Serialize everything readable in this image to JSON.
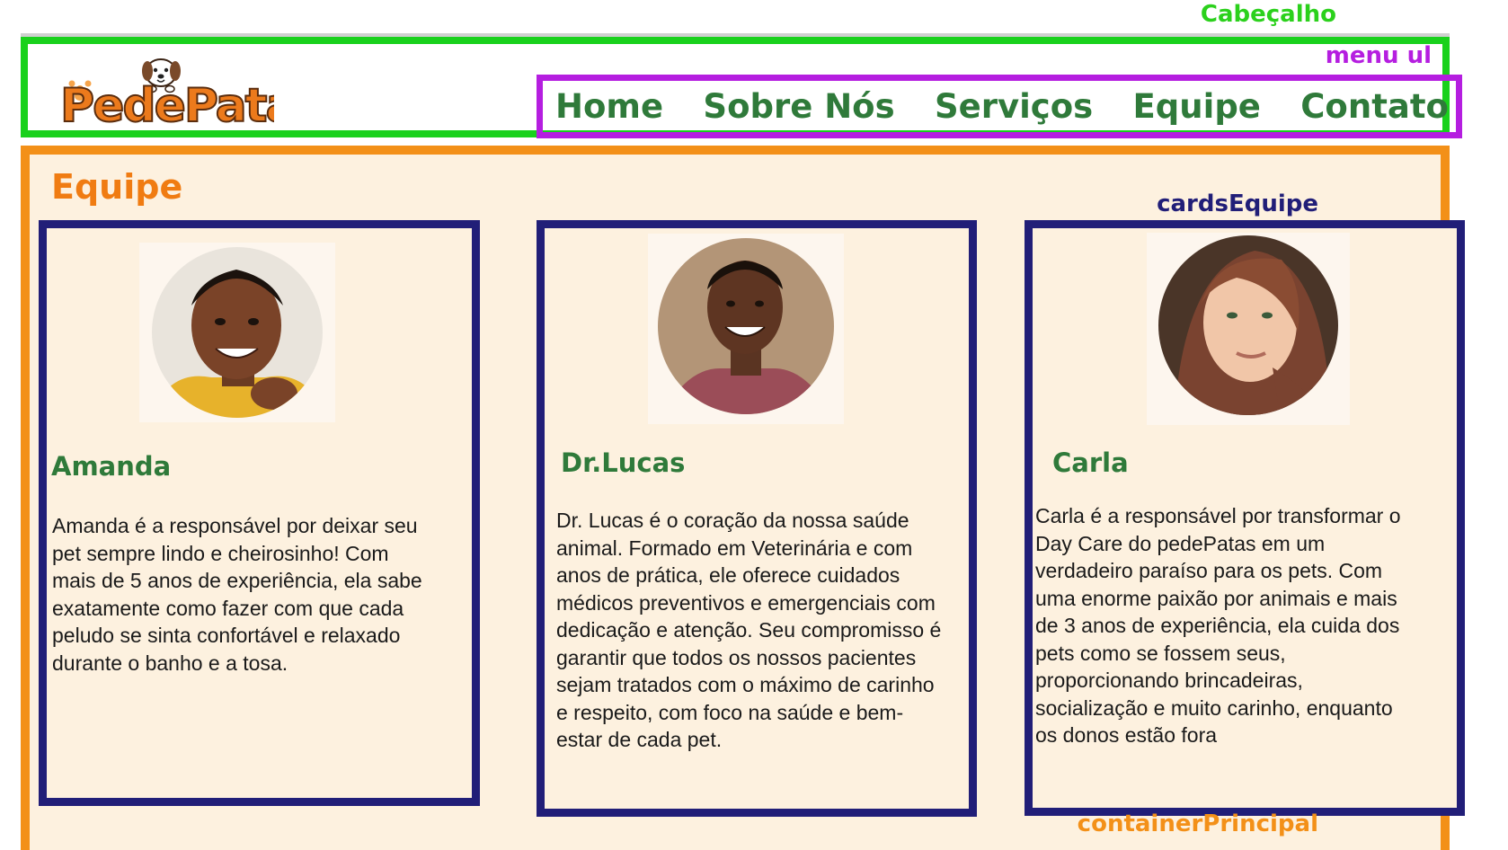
{
  "annotations": {
    "header": "Cabeçalho",
    "menu": "menu ul",
    "cards": "cardsEquipe",
    "main": "containerPrincipal"
  },
  "logo": {
    "text": "PedePata"
  },
  "menu": [
    "Home",
    "Sobre Nós",
    "Serviços",
    "Equipe",
    "Contato"
  ],
  "main": {
    "title": "Equipe"
  },
  "team": [
    {
      "name": "Amanda",
      "text": "Amanda é a responsável por deixar seu\npet sempre lindo e cheirosinho! Com\nmais de 5 anos de experiência, ela sabe\nexatamente como fazer com que cada\npeludo se sinta confortável e relaxado\ndurante o banho e a tosa."
    },
    {
      "name": "Dr.Lucas",
      "text": "Dr. Lucas é o coração da nossa saúde\nanimal. Formado em Veterinária e com\nanos de prática, ele oferece cuidados\nmédicos preventivos e emergenciais com\ndedicação e atenção. Seu compromisso é\ngarantir que todos os nossos pacientes\nsejam tratados com o máximo de carinho\ne respeito, com foco na saúde e bem-\nestar de cada pet."
    },
    {
      "name": "Carla",
      "text": "Carla é a responsável por transformar o\nDay Care do pedePatas em um\nverdadeiro paraíso para os pets. Com\numa enorme paixão por animais e mais\nde 3 anos de experiência, ela cuida dos\npets como se fossem seus,\nproporcionando brincadeiras,\nsocialização e muito carinho, enquanto\nos donos estão fora"
    }
  ],
  "colors": {
    "header_border": "#19d11c",
    "menu_border": "#b51ee0",
    "card_border": "#211e78",
    "main_border": "#f39018",
    "main_bg": "#fdf1df",
    "nav_text": "#2f7a3a",
    "title": "#f07c12"
  }
}
